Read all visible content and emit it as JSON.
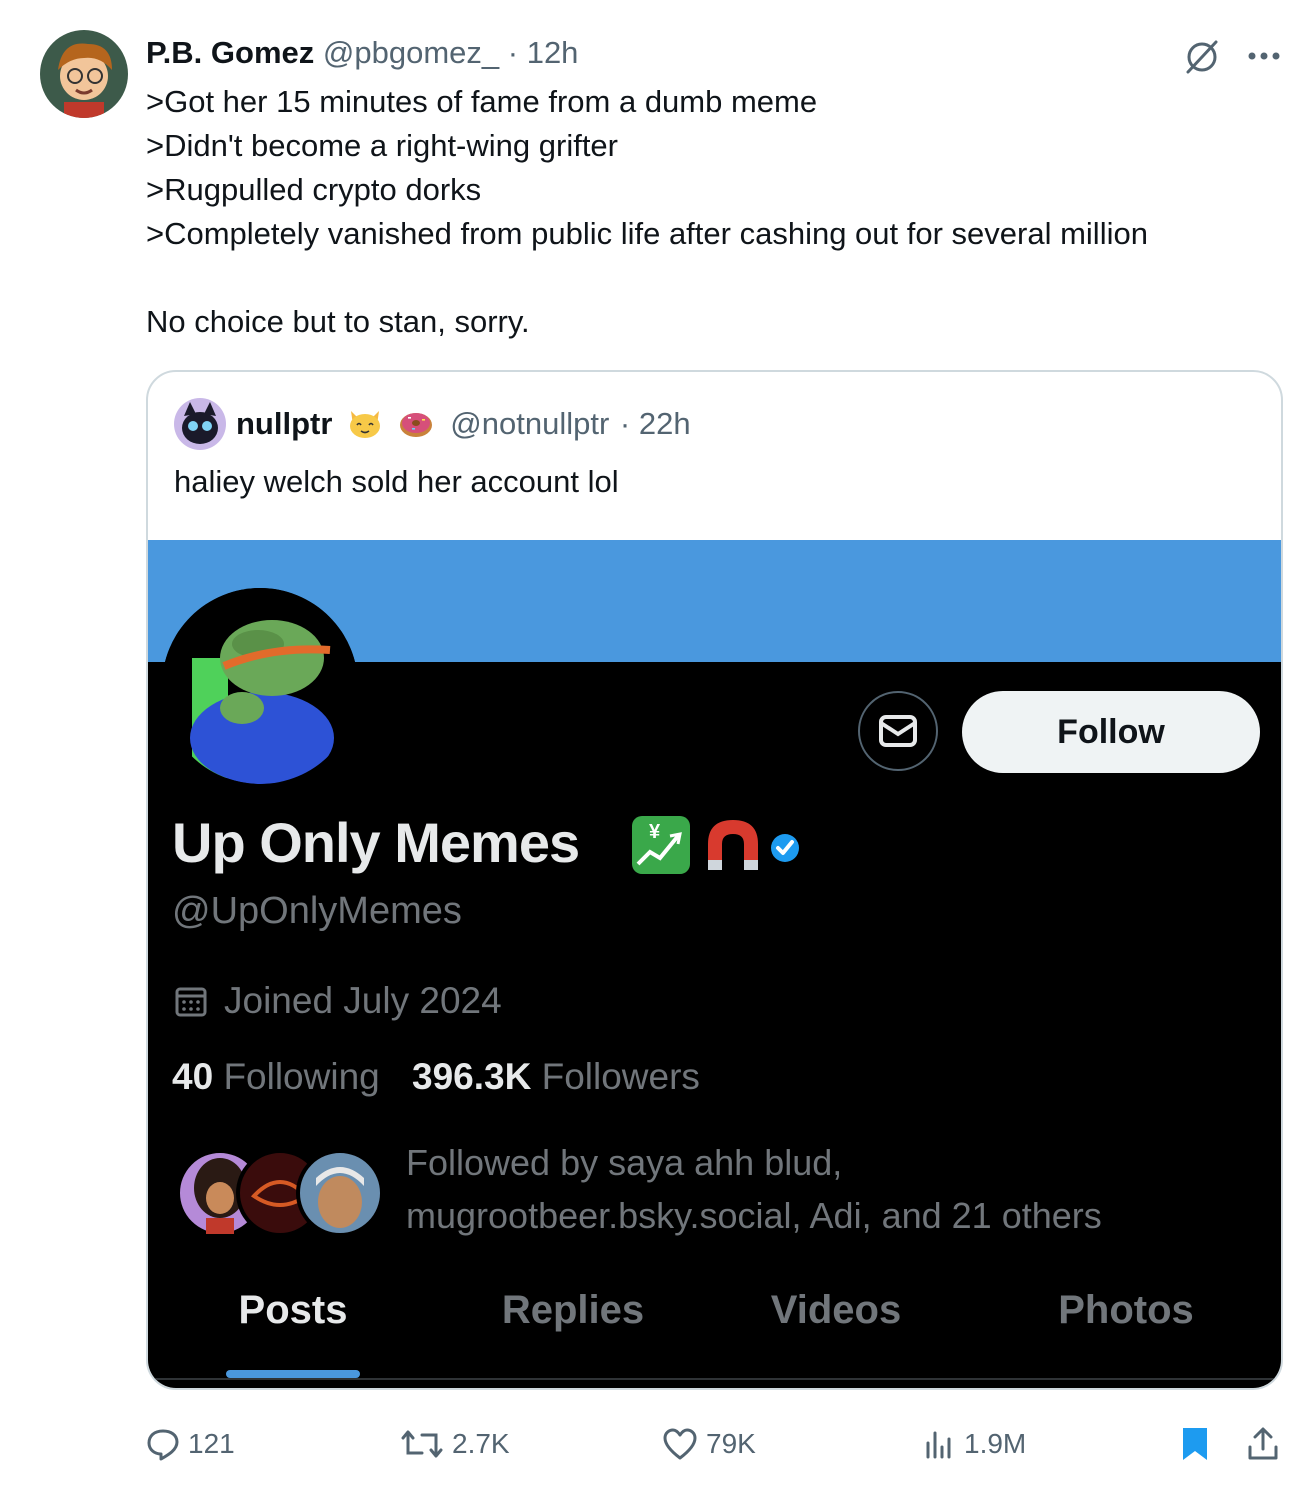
{
  "tweet": {
    "author_name": "P.B. Gomez",
    "author_handle": "@pbgomez_",
    "time": "· 12h",
    "lines": [
      ">Got her 15 minutes of fame from a dumb meme",
      ">Didn't become a right-wing grifter",
      ">Rugpulled crypto dorks",
      ">Completely vanished from public life after cashing out for several million"
    ],
    "closing_line": "No choice but to stan, sorry."
  },
  "quote": {
    "author_name": "nullptr",
    "author_handle": "@notnullptr",
    "time": "· 22h",
    "text": "haliey welch sold her account lol",
    "emoji_icons": [
      "cat-face-icon",
      "donut-icon"
    ]
  },
  "embedded_profile": {
    "display_name": "Up Only Memes",
    "handle": "@UpOnlyMemes",
    "joined": "Joined July 2024",
    "following_count": "40",
    "following_label": "Following",
    "followers_count": "396.3K",
    "followers_label": "Followers",
    "followed_by_line1": "Followed by saya ahh blud,",
    "followed_by_line2": "mugrootbeer.bsky.social, Adi, and 21 others",
    "follow_button": "Follow",
    "tabs": [
      "Posts",
      "Replies",
      "Videos",
      "Photos"
    ],
    "active_tab": "Posts",
    "colors": {
      "banner": "#4a98de",
      "background": "#000000",
      "verified": "#1d9bf0"
    }
  },
  "actions": {
    "replies": "121",
    "reposts": "2.7K",
    "likes": "79K",
    "views": "1.9M"
  }
}
